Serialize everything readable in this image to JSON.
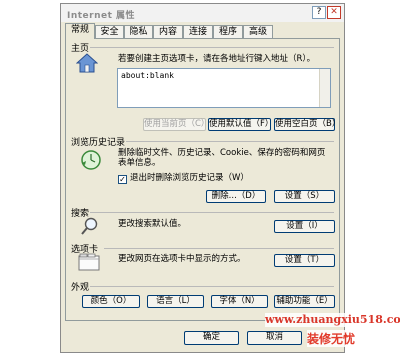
{
  "window": {
    "title": "Internet 属性",
    "help_glyph": "?",
    "close_glyph": "✕"
  },
  "tabs": [
    "常规",
    "安全",
    "隐私",
    "内容",
    "连接",
    "程序",
    "高级"
  ],
  "home": {
    "section_label": "主页",
    "description": "若要创建主页选项卡，请在各地址行键入地址（R）。",
    "url_value": "about:blank",
    "use_current_label": "使用当前页（C）",
    "use_default_label": "使用默认值（F）",
    "use_blank_label": "使用空白页（B）"
  },
  "history": {
    "section_label": "浏览历史记录",
    "description_line1": "删除临时文件、历史记录、Cookie、保存的密码和网页",
    "description_line2": "表单信息。",
    "checkbox_label": "退出时删除浏览历史记录（W）",
    "checkbox_checked": true,
    "check_glyph": "✓",
    "delete_label": "删除...（D）",
    "settings_label": "设置（S）"
  },
  "search": {
    "section_label": "搜索",
    "description": "更改搜索默认值。",
    "settings_label": "设置（I）"
  },
  "tabs_section": {
    "section_label": "选项卡",
    "description": "更改网页在选项卡中显示的方式。",
    "settings_label": "设置（T）"
  },
  "appearance": {
    "section_label": "外观",
    "colors_label": "颜色（O）",
    "languages_label": "语言（L）",
    "fonts_label": "字体（N）",
    "accessibility_label": "辅助功能（E）"
  },
  "footer": {
    "ok_label": "确定",
    "cancel_label": "取消"
  },
  "watermark": {
    "url": "www.zhuangxiu518.com",
    "brand": "装修无忧"
  },
  "colors": {
    "dialog_bg": "#ECE9D8",
    "border": "#919b9c",
    "watermark_red": "#d9362a"
  }
}
